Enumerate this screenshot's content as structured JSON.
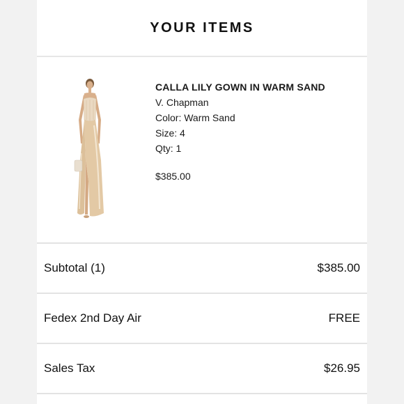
{
  "header": {
    "title": "YOUR ITEMS"
  },
  "item": {
    "name": "CALLA LILY GOWN IN WARM SAND",
    "brand": "V. Chapman",
    "color": "Color: Warm Sand",
    "size": "Size: 4",
    "qty": "Qty: 1",
    "price": "$385.00",
    "image_icon": "gown-product-image"
  },
  "summary": [
    {
      "label": "Subtotal (1)",
      "value": "$385.00"
    },
    {
      "label": "Fedex 2nd Day Air",
      "value": "FREE"
    },
    {
      "label": "Sales Tax",
      "value": "$26.95"
    }
  ],
  "colors": {
    "background": "#f2f2f2",
    "card": "#ffffff",
    "divider": "#e3e3e3",
    "gown": "#e6cfae"
  }
}
